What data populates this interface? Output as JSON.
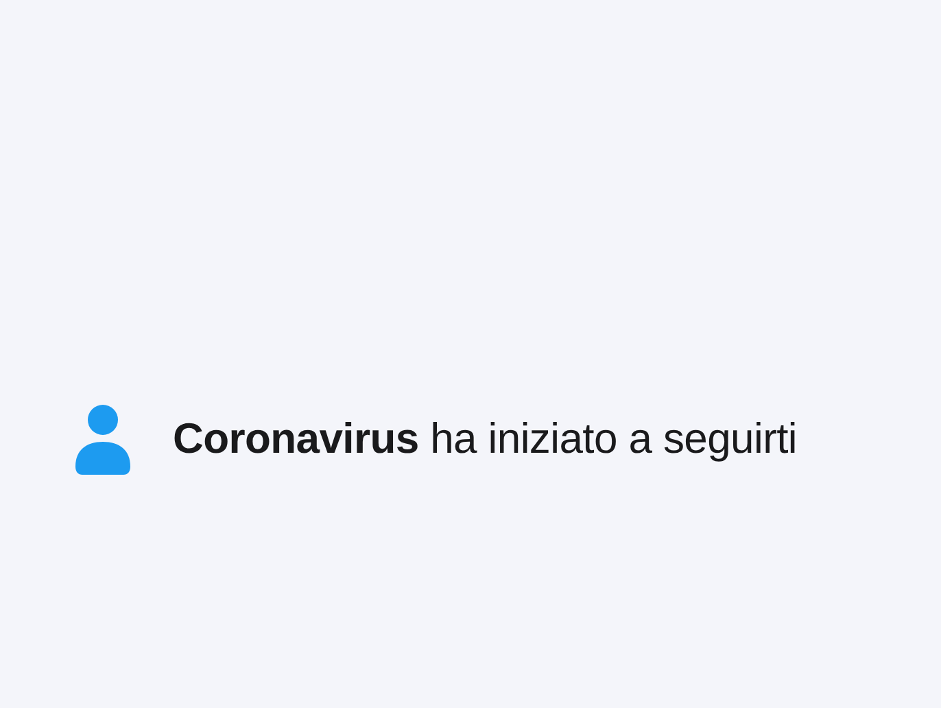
{
  "notification": {
    "text": "**Coronavirus** ha iniziato a seguirti"
  }
}
